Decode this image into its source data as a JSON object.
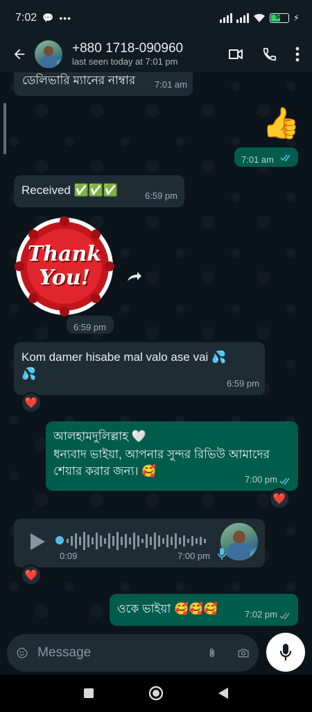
{
  "status_bar": {
    "time": "7:02",
    "battery_level": "56"
  },
  "header": {
    "title": "+880 1718-090960",
    "subtitle": "last seen today at 7:01 pm"
  },
  "messages": {
    "m1": {
      "text": "ডেলিভারি ম্যানের নাম্বার",
      "time": "7:01 am"
    },
    "m2": {
      "emoji": "👍",
      "time": "7:01 am"
    },
    "m3": {
      "text": "Received ✅✅✅",
      "time": "6:59 pm"
    },
    "m4": {
      "sticker_line1": "Thank",
      "sticker_line2": "You!",
      "time": "6:59 pm"
    },
    "m5": {
      "text": "Kom damer hisabe mal valo ase vai 💦 💦",
      "time": "6:59 pm",
      "reaction": "❤️"
    },
    "m6": {
      "line1": "আলহামদুলিল্লাহ 🤍",
      "line2": "ধন্যবাদ ভাইয়া, আপনার সুন্দর রিভিউ আমাদের শেয়ার করার জন্য। 🥰",
      "time": "7:00 pm",
      "reaction": "❤️"
    },
    "m7": {
      "duration": "0:09",
      "time": "7:00 pm",
      "reaction": "❤️",
      "progress": 0
    },
    "m8": {
      "text": "ওকে ভাইয়া 🥰🥰🥰",
      "time": "7:02 pm"
    }
  },
  "composer": {
    "placeholder": "Message"
  },
  "colors": {
    "incoming": "#202c33",
    "outgoing": "#005c4b",
    "accent": "#53bdeb",
    "background": "#0b141a"
  }
}
